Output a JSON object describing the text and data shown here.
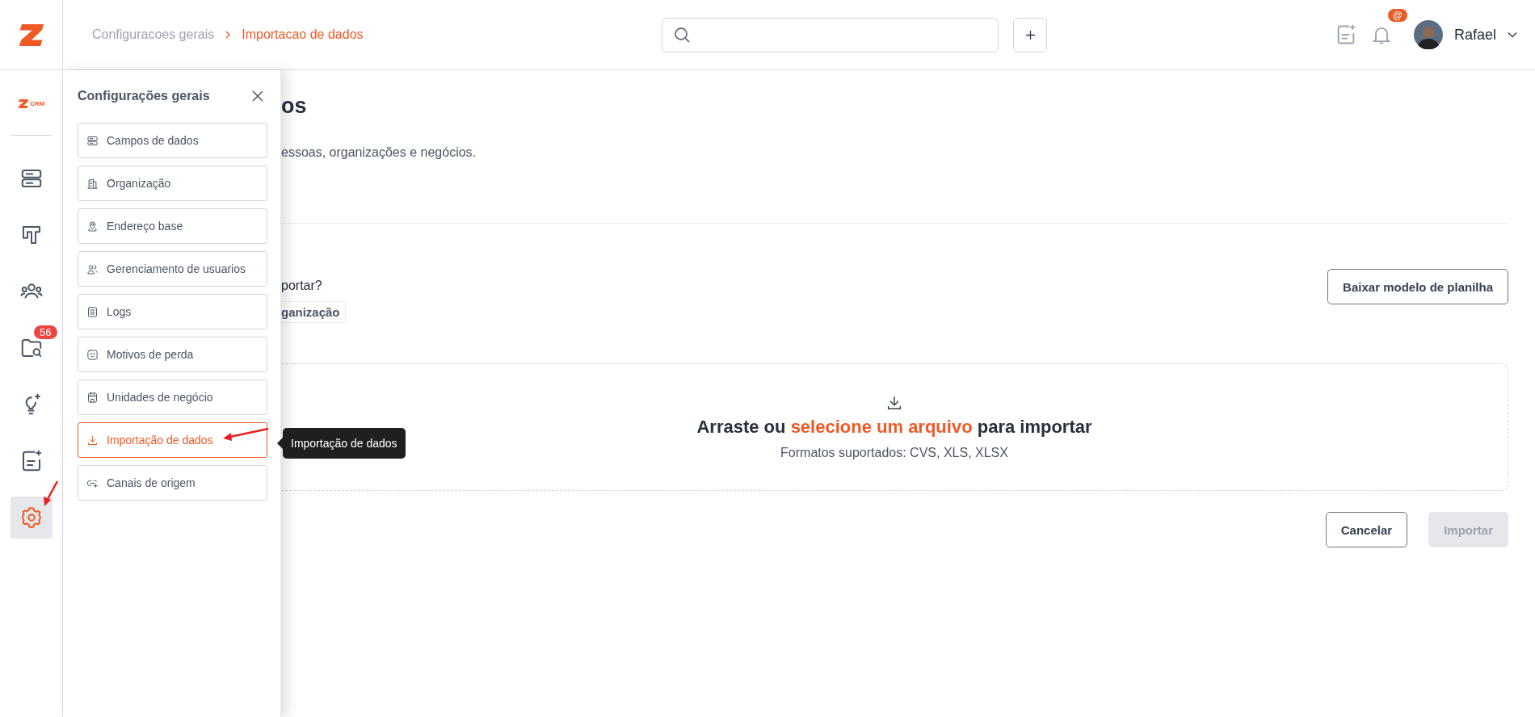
{
  "topbar": {
    "breadcrumb": [
      {
        "label": "Configuracoes gerais",
        "current": false
      },
      {
        "label": "Importacao de dados",
        "current": true
      }
    ],
    "notification_badge": "@",
    "user": {
      "name": "Rafael"
    }
  },
  "rail": {
    "brand": "CRM",
    "items": [
      {
        "selected": false
      },
      {
        "selected": false
      },
      {
        "selected": false
      },
      {
        "selected": false,
        "badge": "56"
      },
      {
        "selected": false
      },
      {
        "selected": false
      },
      {
        "selected": true
      }
    ]
  },
  "panel": {
    "title": "Configurações gerais",
    "items": [
      {
        "label": "Campos de dados",
        "selected": false
      },
      {
        "label": "Organização",
        "selected": false
      },
      {
        "label": "Endereço base",
        "selected": false
      },
      {
        "label": "Gerenciamento de usuarios",
        "selected": false
      },
      {
        "label": "Logs",
        "selected": false
      },
      {
        "label": "Motivos de perda",
        "selected": false
      },
      {
        "label": "Unidades de negócio",
        "selected": false
      },
      {
        "label": "Importação de dados",
        "selected": true
      },
      {
        "label": "Canais de origem",
        "selected": false
      }
    ]
  },
  "tooltip": "Importação de dados",
  "page": {
    "title": "os",
    "description": "essoas, organizações e negócios.",
    "question": "portar?",
    "chip": "ganização",
    "template_button": "Baixar modelo de planilha",
    "dropzone": {
      "text_before": "Arraste ou",
      "link": "selecione um arquivo",
      "text_after": "para importar",
      "formats": "Formatos suportados: CVS, XLS, XLSX"
    },
    "buttons": [
      {
        "label": "Cancelar",
        "disabled": false
      },
      {
        "label": "Importar",
        "disabled": true
      }
    ]
  }
}
